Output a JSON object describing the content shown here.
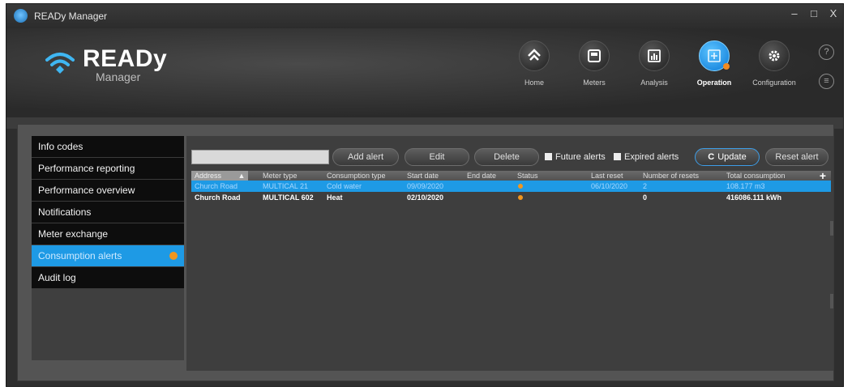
{
  "window": {
    "title": "READy Manager",
    "controls": [
      "–",
      "□",
      "X"
    ]
  },
  "logo": {
    "title": "READy",
    "subtitle": "Manager"
  },
  "nav": [
    {
      "label": "Home",
      "icon": "home-icon",
      "active": false
    },
    {
      "label": "Meters",
      "icon": "meter-icon",
      "active": false
    },
    {
      "label": "Analysis",
      "icon": "analysis-icon",
      "active": false
    },
    {
      "label": "Operation",
      "icon": "operation-icon",
      "active": true
    },
    {
      "label": "Configuration",
      "icon": "gear-icon",
      "active": false
    }
  ],
  "help": {
    "help_glyph": "?",
    "chat_glyph": "≡"
  },
  "sidebar": {
    "items": [
      {
        "label": "Info codes"
      },
      {
        "label": "Performance reporting"
      },
      {
        "label": "Performance overview"
      },
      {
        "label": "Notifications"
      },
      {
        "label": "Meter exchange"
      },
      {
        "label": "Consumption alerts"
      },
      {
        "label": "Audit log"
      }
    ],
    "active_index": 5
  },
  "toolbar": {
    "search_value": "",
    "add_alert": "Add alert",
    "edit": "Edit",
    "delete": "Delete",
    "future_alerts": "Future alerts",
    "expired_alerts": "Expired alerts",
    "update_icon": "C",
    "update": "Update",
    "reset_alert": "Reset alert"
  },
  "table": {
    "sort_indicator": "▲",
    "add_column": "+",
    "columns": [
      "Address",
      "Meter type",
      "Consumption type",
      "Start date",
      "End date",
      "Status",
      "Last reset",
      "Number of resets",
      "Total consumption"
    ],
    "rows": [
      {
        "address": "Church Road",
        "meter_type": "MULTICAL 21",
        "consumption_type": "Cold water",
        "start_date": "09/09/2020",
        "end_date": "",
        "last_reset": "06/10/2020",
        "number_of_resets": "2",
        "total_consumption": "108.177 m3"
      },
      {
        "address": "Church Road",
        "meter_type": "MULTICAL 602",
        "consumption_type": "Heat",
        "start_date": "02/10/2020",
        "end_date": "",
        "last_reset": "",
        "number_of_resets": "0",
        "total_consumption": "416086.111 kWh"
      }
    ]
  },
  "colors": {
    "accent": "#1e9ae5",
    "status_dot": "#f0961f"
  }
}
